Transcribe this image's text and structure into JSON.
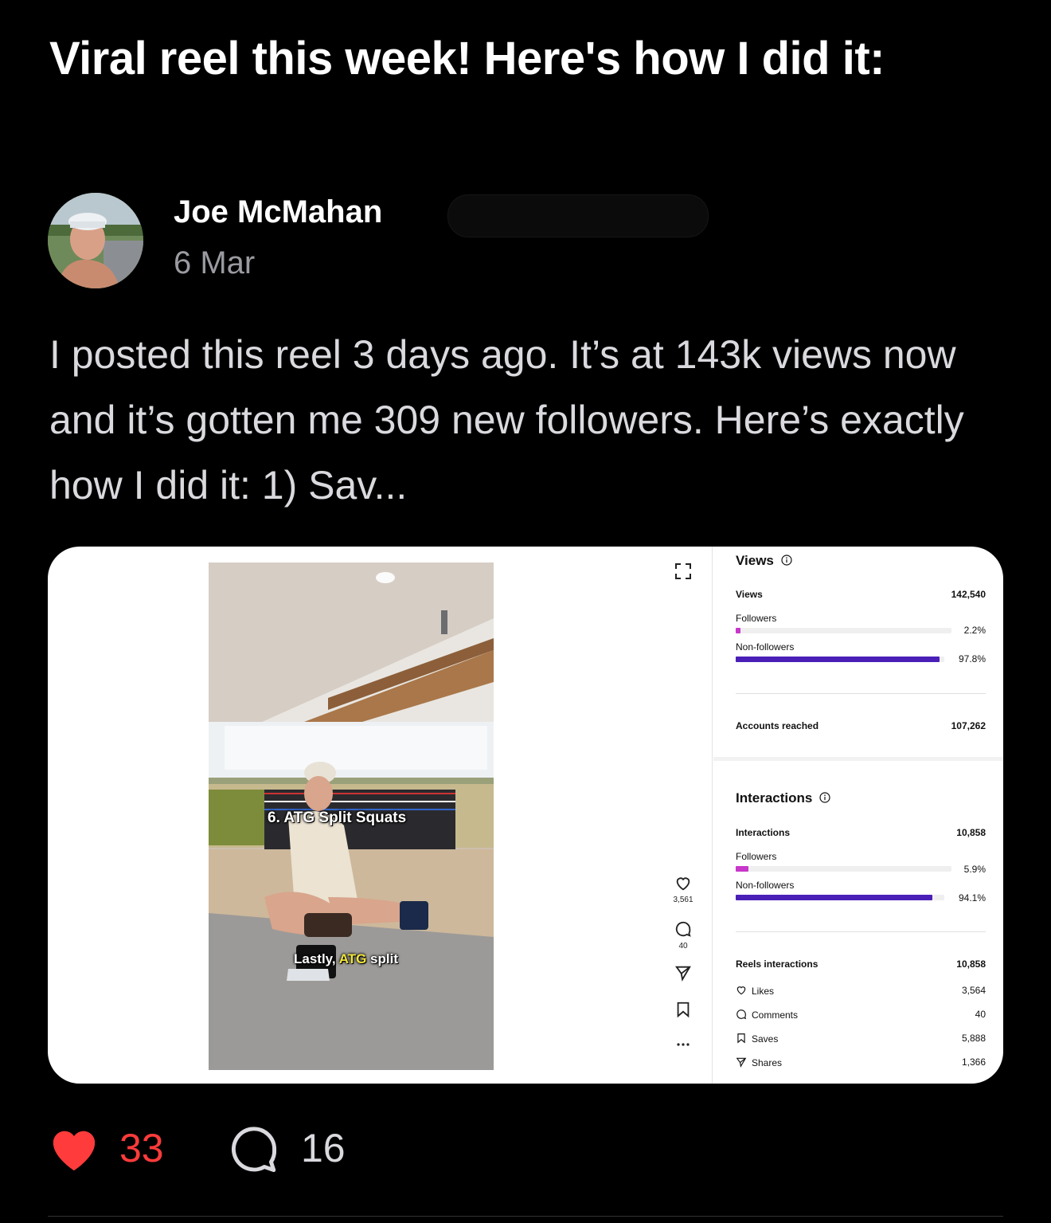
{
  "post": {
    "title": "Viral reel this week! Here's how I did it:",
    "author": "Joe McMahan",
    "date": "6 Mar",
    "body": "I posted this reel 3 days ago. It’s at 143k views now and it’s gotten me 309 new followers. Here’s exactly how I did it: 1) Sav..."
  },
  "reel": {
    "caption_top": "6. ATG Split Squats",
    "caption_bottom_pre": "Lastly, ",
    "caption_bottom_hl": "ATG",
    "caption_bottom_post": " split",
    "likes": "3,561",
    "comments": "40"
  },
  "insights": {
    "views_title": "Views",
    "views_label": "Views",
    "views_value": "142,540",
    "views_followers_label": "Followers",
    "views_followers_pct": "2.2%",
    "views_followers_fraction": 0.022,
    "views_nonfollowers_label": "Non-followers",
    "views_nonfollowers_pct": "97.8%",
    "views_nonfollowers_fraction": 0.978,
    "accounts_reached_label": "Accounts reached",
    "accounts_reached_value": "107,262",
    "interactions_title": "Interactions",
    "interactions_label": "Interactions",
    "interactions_value": "10,858",
    "int_followers_label": "Followers",
    "int_followers_pct": "5.9%",
    "int_followers_fraction": 0.059,
    "int_nonfollowers_label": "Non-followers",
    "int_nonfollowers_pct": "94.1%",
    "int_nonfollowers_fraction": 0.941,
    "reels_interactions_label": "Reels interactions",
    "reels_interactions_value": "10,858",
    "likes_label": "Likes",
    "likes_value": "3,564",
    "comments_label": "Comments",
    "comments_value": "40",
    "saves_label": "Saves",
    "saves_value": "5,888",
    "shares_label": "Shares",
    "shares_value": "1,366"
  },
  "footer": {
    "like_count": "33",
    "comment_count": "16"
  },
  "colors": {
    "background": "#000000",
    "like_red": "#ff3b3b",
    "follower_bar": "#c837c9",
    "nonfollower_bar": "#4a1fb8"
  }
}
